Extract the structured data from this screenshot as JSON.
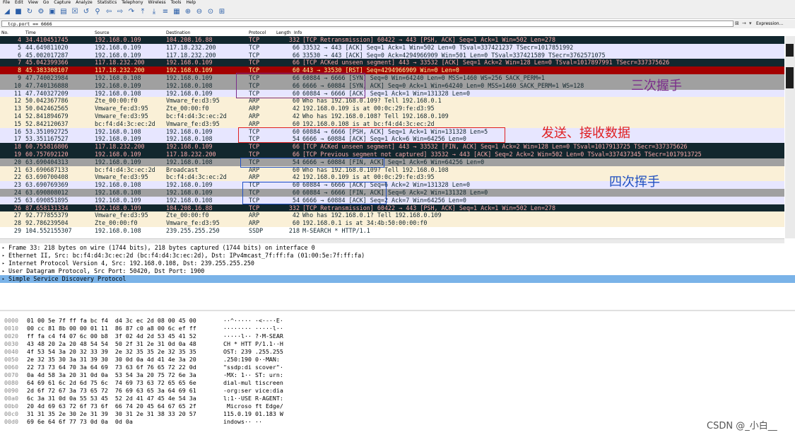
{
  "menu": [
    "File",
    "Edit",
    "View",
    "Go",
    "Capture",
    "Analyze",
    "Statistics",
    "Telephony",
    "Wireless",
    "Tools",
    "Help"
  ],
  "toolbar_icons": [
    "shark-fin-icon",
    "stop-icon",
    "restart-icon",
    "options-icon",
    "open-icon",
    "save-icon",
    "close-file-icon",
    "reload-icon",
    "find-icon",
    "back-icon",
    "forward-icon",
    "goto-icon",
    "first-icon",
    "last-icon",
    "autoscroll-icon",
    "colorize-icon",
    "zoom-in-icon",
    "zoom-out-icon",
    "zoom-reset-icon",
    "resize-columns-icon"
  ],
  "filter": {
    "value": "tcp.port == 6666",
    "expression_label": "Expression..."
  },
  "columns": {
    "no": "No.",
    "time": "Time",
    "source": "Source",
    "destination": "Destination",
    "protocol": "Protocol",
    "length": "Length",
    "info": "Info"
  },
  "packets": [
    {
      "no": "4",
      "time": "34.410451745",
      "src": "192.168.0.109",
      "dst": "104.208.16.88",
      "proto": "TCP",
      "len": "332",
      "info": "[TCP Retransmission] 60422 → 443 [PSH, ACK] Seq=1 Ack=1 Win=502 Len=278",
      "bg": "#12272e",
      "fg": "#f7a8a8"
    },
    {
      "no": "5",
      "time": "44.649811020",
      "src": "192.168.0.109",
      "dst": "117.18.232.200",
      "proto": "TCP",
      "len": "66",
      "info": "33532 → 443 [ACK] Seq=1 Ack=1 Win=502 Len=0 TSval=337421237 TSecr=1017851992",
      "bg": "#e7e6ff",
      "fg": "#12272e"
    },
    {
      "no": "6",
      "time": "45.002017287",
      "src": "192.168.0.109",
      "dst": "117.18.232.200",
      "proto": "TCP",
      "len": "66",
      "info": "33530 → 443 [ACK] Seq=0 Ack=4294966909 Win=501 Len=0 TSval=337421589 TSecr=3762571075",
      "bg": "#e7e6ff",
      "fg": "#12272e"
    },
    {
      "no": "7",
      "time": "45.042399366",
      "src": "117.18.232.200",
      "dst": "192.168.0.109",
      "proto": "TCP",
      "len": "66",
      "info": "[TCP ACKed unseen segment] 443 → 33532 [ACK] Seq=1 Ack=2 Win=128 Len=0 TSval=1017897991 TSecr=337375626",
      "bg": "#12272e",
      "fg": "#f7a8a8"
    },
    {
      "no": "8",
      "time": "45.383308107",
      "src": "117.18.232.200",
      "dst": "192.168.0.109",
      "proto": "TCP",
      "len": "60",
      "info": "443 → 33530 [RST] Seq=4294966909 Win=0 Len=0",
      "bg": "#a40000",
      "fg": "#fffc9c"
    },
    {
      "no": "9",
      "time": "47.740023984",
      "src": "192.168.0.108",
      "dst": "192.168.0.109",
      "proto": "TCP",
      "len": "66",
      "info": "60884 → 6666 [SYN] Seq=0 Win=64240 Len=0 MSS=1460 WS=256 SACK_PERM=1",
      "bg": "#a0a0a0",
      "fg": "#12272e"
    },
    {
      "no": "10",
      "time": "47.740136888",
      "src": "192.168.0.109",
      "dst": "192.168.0.108",
      "proto": "TCP",
      "len": "66",
      "info": "6666 → 60884 [SYN, ACK] Seq=0 Ack=1 Win=64240 Len=0 MSS=1460 SACK_PERM=1 WS=128",
      "bg": "#a0a0a0",
      "fg": "#12272e"
    },
    {
      "no": "11",
      "time": "47.740327209",
      "src": "192.168.0.108",
      "dst": "192.168.0.109",
      "proto": "TCP",
      "len": "60",
      "info": "60884 → 6666 [ACK] Seq=1 Ack=1 Win=131328 Len=0",
      "bg": "#e7e6ff",
      "fg": "#12272e"
    },
    {
      "no": "12",
      "time": "50.042367786",
      "src": "Zte_00:00:f0",
      "dst": "Vmware_fe:d3:95",
      "proto": "ARP",
      "len": "60",
      "info": "Who has 192.168.0.109? Tell 192.168.0.1",
      "bg": "#faf0d7",
      "fg": "#12272e"
    },
    {
      "no": "13",
      "time": "50.042462565",
      "src": "Vmware_fe:d3:95",
      "dst": "Zte_00:00:f0",
      "proto": "ARP",
      "len": "42",
      "info": "192.168.0.109 is at 00:0c:29:fe:d3:95",
      "bg": "#faf0d7",
      "fg": "#12272e"
    },
    {
      "no": "14",
      "time": "52.841894679",
      "src": "Vmware_fe:d3:95",
      "dst": "bc:f4:d4:3c:ec:2d",
      "proto": "ARP",
      "len": "42",
      "info": "Who has 192.168.0.108? Tell 192.168.0.109",
      "bg": "#faf0d7",
      "fg": "#12272e"
    },
    {
      "no": "15",
      "time": "52.842120637",
      "src": "bc:f4:d4:3c:ec:2d",
      "dst": "Vmware_fe:d3:95",
      "proto": "ARP",
      "len": "60",
      "info": "192.168.0.108 is at bc:f4:d4:3c:ec:2d",
      "bg": "#faf0d7",
      "fg": "#12272e"
    },
    {
      "no": "16",
      "time": "53.351092725",
      "src": "192.168.0.108",
      "dst": "192.168.0.109",
      "proto": "TCP",
      "len": "60",
      "info": "60884 → 6666 [PSH, ACK] Seq=1 Ack=1 Win=131328 Len=5",
      "bg": "#e7e6ff",
      "fg": "#12272e"
    },
    {
      "no": "17",
      "time": "53.351167527",
      "src": "192.168.0.109",
      "dst": "192.168.0.108",
      "proto": "TCP",
      "len": "54",
      "info": "6666 → 60884 [ACK] Seq=1 Ack=6 Win=64256 Len=0",
      "bg": "#e7e6ff",
      "fg": "#12272e"
    },
    {
      "no": "18",
      "time": "60.755816806",
      "src": "117.18.232.200",
      "dst": "192.168.0.109",
      "proto": "TCP",
      "len": "66",
      "info": "[TCP ACKed unseen segment] 443 → 33532 [FIN, ACK] Seq=1 Ack=2 Win=128 Len=0 TSval=1017913725 TSecr=337375626",
      "bg": "#12272e",
      "fg": "#f7a8a8"
    },
    {
      "no": "19",
      "time": "60.757692120",
      "src": "192.168.0.109",
      "dst": "117.18.232.200",
      "proto": "TCP",
      "len": "66",
      "info": "[TCP Previous segment not captured] 33532 → 443 [ACK] Seq=2 Ack=2 Win=502 Len=0 TSval=337437345 TSecr=1017913725",
      "bg": "#12272e",
      "fg": "#f7a8a8"
    },
    {
      "no": "20",
      "time": "63.690404313",
      "src": "192.168.0.109",
      "dst": "192.168.0.108",
      "proto": "TCP",
      "len": "54",
      "info": "6666 → 60884 [FIN, ACK] Seq=1 Ack=6 Win=64256 Len=0",
      "bg": "#a0a0a0",
      "fg": "#12272e"
    },
    {
      "no": "21",
      "time": "63.690687133",
      "src": "bc:f4:d4:3c:ec:2d",
      "dst": "Broadcast",
      "proto": "ARP",
      "len": "60",
      "info": "Who has 192.168.0.109? Tell 192.168.0.108",
      "bg": "#faf0d7",
      "fg": "#12272e"
    },
    {
      "no": "22",
      "time": "63.690700408",
      "src": "Vmware_fe:d3:95",
      "dst": "bc:f4:d4:3c:ec:2d",
      "proto": "ARP",
      "len": "42",
      "info": "192.168.0.109 is at 00:0c:29:fe:d3:95",
      "bg": "#faf0d7",
      "fg": "#12272e"
    },
    {
      "no": "23",
      "time": "63.690769369",
      "src": "192.168.0.108",
      "dst": "192.168.0.109",
      "proto": "TCP",
      "len": "60",
      "info": "60884 → 6666 [ACK] Seq=6 Ack=2 Win=131328 Len=0",
      "bg": "#e7e6ff",
      "fg": "#12272e"
    },
    {
      "no": "24",
      "time": "63.690808012",
      "src": "192.168.0.108",
      "dst": "192.168.0.109",
      "proto": "TCP",
      "len": "60",
      "info": "60884 → 6666 [FIN, ACK] Seq=6 Ack=2 Win=131328 Len=0",
      "bg": "#a0a0a0",
      "fg": "#12272e"
    },
    {
      "no": "25",
      "time": "63.690851895",
      "src": "192.168.0.109",
      "dst": "192.168.0.108",
      "proto": "TCP",
      "len": "54",
      "info": "6666 → 60884 [ACK] Seq=2 Ack=7 Win=64256 Len=0",
      "bg": "#e7e6ff",
      "fg": "#12272e"
    },
    {
      "no": "26",
      "time": "87.658131334",
      "src": "192.168.0.109",
      "dst": "104.208.16.88",
      "proto": "TCP",
      "len": "332",
      "info": "[TCP Retransmission] 60422 → 443 [PSH, ACK] Seq=1 Ack=1 Win=502 Len=278",
      "bg": "#12272e",
      "fg": "#f7a8a8"
    },
    {
      "no": "27",
      "time": "92.777855379",
      "src": "Vmware_fe:d3:95",
      "dst": "Zte_00:00:f0",
      "proto": "ARP",
      "len": "42",
      "info": "Who has 192.168.0.1? Tell 192.168.0.109",
      "bg": "#faf0d7",
      "fg": "#12272e"
    },
    {
      "no": "28",
      "time": "92.786239504",
      "src": "Zte_00:00:f0",
      "dst": "Vmware_fe:d3:95",
      "proto": "ARP",
      "len": "60",
      "info": "192.168.0.1 is at 34:4b:50:00:00:f0",
      "bg": "#faf0d7",
      "fg": "#12272e"
    },
    {
      "no": "29",
      "time": "104.552155307",
      "src": "192.168.0.108",
      "dst": "239.255.255.250",
      "proto": "SSDP",
      "len": "218",
      "info": "M-SEARCH * HTTP/1.1",
      "bg": "#ffffff",
      "fg": "#12272e"
    }
  ],
  "details": [
    {
      "text": "Frame 33: 218 bytes on wire (1744 bits), 218 bytes captured (1744 bits) on interface 0",
      "selected": false
    },
    {
      "text": "Ethernet II, Src: bc:f4:d4:3c:ec:2d (bc:f4:d4:3c:ec:2d), Dst: IPv4mcast_7f:ff:fa (01:00:5e:7f:ff:fa)",
      "selected": false
    },
    {
      "text": "Internet Protocol Version 4, Src: 192.168.0.108, Dst: 239.255.255.250",
      "selected": false
    },
    {
      "text": "User Datagram Protocol, Src Port: 50420, Dst Port: 1900",
      "selected": false
    },
    {
      "text": "Simple Service Discovery Protocol",
      "selected": true
    }
  ],
  "hex": [
    {
      "off": "0000",
      "bytes": "01 00 5e 7f ff fa bc f4  d4 3c ec 2d 08 00 45 00",
      "ascii": "··^····· ·<·-··E·"
    },
    {
      "off": "0010",
      "bytes": "00 cc 81 8b 00 00 01 11  86 87 c0 a8 00 6c ef ff",
      "ascii": "········ ·····l··"
    },
    {
      "off": "0020",
      "bytes": "ff fa c4 f4 07 6c 00 b8  3f 02 4d 2d 53 45 41 52",
      "ascii": "·····l·· ?·M-SEAR"
    },
    {
      "off": "0030",
      "bytes": "43 48 20 2a 20 48 54 54  50 2f 31 2e 31 0d 0a 48",
      "ascii": "CH * HTT P/1.1··H"
    },
    {
      "off": "0040",
      "bytes": "4f 53 54 3a 20 32 33 39  2e 32 35 35 2e 32 35 35",
      "ascii": "OST: 239 .255.255"
    },
    {
      "off": "0050",
      "bytes": "2e 32 35 30 3a 31 39 30  30 0d 0a 4d 41 4e 3a 20",
      "ascii": ".250:190 0··MAN: "
    },
    {
      "off": "0060",
      "bytes": "22 73 73 64 70 3a 64 69  73 63 6f 76 65 72 22 0d",
      "ascii": "\"ssdp:di scover\"·"
    },
    {
      "off": "0070",
      "bytes": "0a 4d 58 3a 20 31 0d 0a  53 54 3a 20 75 72 6e 3a",
      "ascii": "·MX: 1·· ST: urn:"
    },
    {
      "off": "0080",
      "bytes": "64 69 61 6c 2d 6d 75 6c  74 69 73 63 72 65 65 6e",
      "ascii": "dial-mul tiscreen"
    },
    {
      "off": "0090",
      "bytes": "2d 6f 72 67 3a 73 65 72  76 69 63 65 3a 64 69 61",
      "ascii": "-org:ser vice:dia"
    },
    {
      "off": "00a0",
      "bytes": "6c 3a 31 0d 0a 55 53 45  52 2d 41 47 45 4e 54 3a",
      "ascii": "l:1··USE R-AGENT:"
    },
    {
      "off": "00b0",
      "bytes": "20 4d 69 63 72 6f 73 6f  66 74 20 45 64 67 65 2f",
      "ascii": " Microso ft Edge/"
    },
    {
      "off": "00c0",
      "bytes": "31 31 35 2e 30 2e 31 39  30 31 2e 31 38 33 20 57",
      "ascii": "115.0.19 01.183 W"
    },
    {
      "off": "00d0",
      "bytes": "69 6e 64 6f 77 73 0d 0a  0d 0a",
      "ascii": "indows·· ··"
    }
  ],
  "annotations": {
    "handshake": "三次握手",
    "data_transfer": "发送、接收数据",
    "wave": "四次挥手"
  },
  "watermark": "CSDN @_小白__"
}
